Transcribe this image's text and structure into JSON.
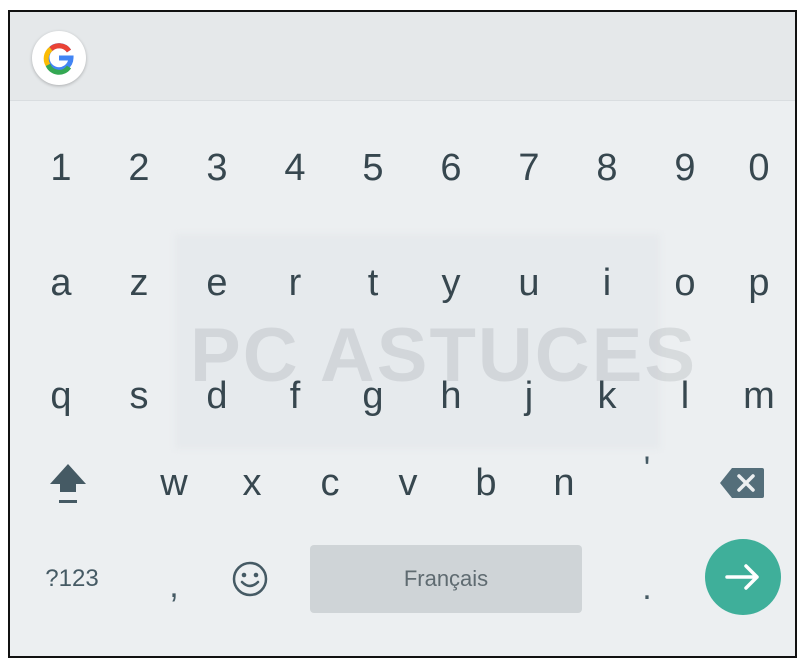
{
  "keyboard": {
    "search_logo": "Google",
    "number_row": [
      "1",
      "2",
      "3",
      "4",
      "5",
      "6",
      "7",
      "8",
      "9",
      "0"
    ],
    "letter_row_1": [
      "a",
      "z",
      "e",
      "r",
      "t",
      "y",
      "u",
      "i",
      "o",
      "p"
    ],
    "letter_row_2": [
      "q",
      "s",
      "d",
      "f",
      "g",
      "h",
      "j",
      "k",
      "l",
      "m"
    ],
    "letter_row_3": [
      "w",
      "x",
      "c",
      "v",
      "b",
      "n",
      "'"
    ],
    "symbols_key": "?123",
    "comma_key": ",",
    "space_label": "Français",
    "period_key": ".",
    "icons": {
      "shift": "shift-icon",
      "backspace": "backspace-icon",
      "emoji": "emoji-icon",
      "enter": "arrow-right-icon"
    },
    "watermark": "PC ASTUCES",
    "colors": {
      "background": "#eceff1",
      "key_text": "#37474f",
      "space_bar": "#cfd4d7",
      "enter_button": "#3faf9a"
    }
  }
}
